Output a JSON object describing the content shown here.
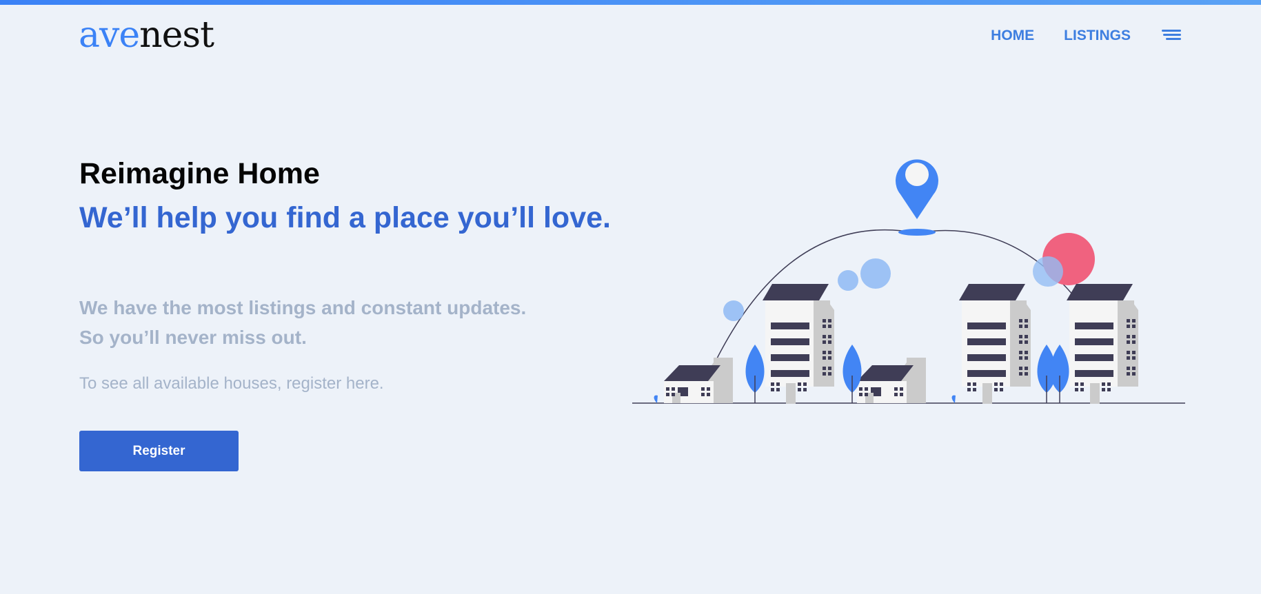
{
  "brand": {
    "logo_part1": "ave",
    "logo_part2": "nest"
  },
  "nav": {
    "items": [
      {
        "label": "HOME"
      },
      {
        "label": "LISTINGS"
      }
    ],
    "menu_icon": "hamburger-menu-icon"
  },
  "hero": {
    "title": "Reimagine Home",
    "subtitle": "We’ll help you find a place you’ll love.",
    "description_line1": "We have the most listings and constant updates.",
    "description_line2": "So you’ll never miss out.",
    "note": "To see all available houses, register here.",
    "cta_label": "Register"
  },
  "colors": {
    "background": "#edf2f9",
    "primary": "#3466d1",
    "nav_link": "#3d7ee0",
    "muted_text": "#a4b3c9",
    "building_dark": "#3f3d56",
    "pin_blue": "#4285f4",
    "bubble_pink": "#f0627f"
  }
}
